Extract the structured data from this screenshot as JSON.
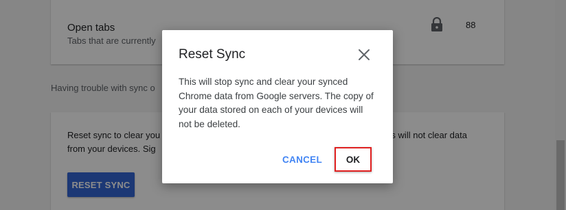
{
  "background": {
    "open_tabs": {
      "title": "Open tabs",
      "subtitle": "Tabs that are currently",
      "count": "88",
      "lock_icon": "lock-icon"
    },
    "trouble_text": "Having trouble with sync o",
    "reset_card": {
      "description": "Reset sync to clear your data from Google servers and remove sync data. This will not clear data from your devices. Sig",
      "description_visible_left_line1": "Reset sync to clear you",
      "description_visible_right_line1": "This will not clear data",
      "description_visible_left_line2": "from your devices. Sig",
      "button_label": "RESET SYNC"
    }
  },
  "dialog": {
    "title": "Reset Sync",
    "close_icon": "close-icon",
    "body": "This will stop sync and clear your synced Chrome data from Google servers. The copy of your data stored on each of your devices will not be deleted.",
    "cancel_label": "CANCEL",
    "ok_label": "OK"
  },
  "colors": {
    "accent": "#4285f4",
    "primary_button": "#3367d6",
    "highlight_border": "#e02020",
    "overlay": "rgba(0,0,0,0.45)"
  }
}
